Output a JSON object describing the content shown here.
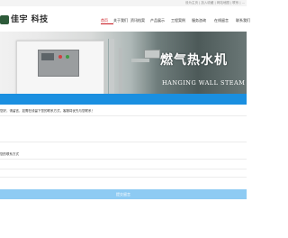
{
  "topbar": {
    "links": "设为主页 | 加入收藏 | 网站地图 | 联系 | ..."
  },
  "header": {
    "logo_text": "佳宇 科技",
    "nav": [
      {
        "label": "首页",
        "active": true
      },
      {
        "label": "关于我们",
        "active": false
      },
      {
        "label": "资讯档案",
        "active": false
      },
      {
        "label": "产品展示",
        "active": false
      },
      {
        "label": "工程案例",
        "active": false
      },
      {
        "label": "服务咨询",
        "active": false
      },
      {
        "label": "在线留言",
        "active": false
      },
      {
        "label": "联系我们",
        "active": false
      }
    ]
  },
  "hero": {
    "title": "燃气热水机",
    "subtitle": "HANGING WALL STEAM ENGINE"
  },
  "form": {
    "notice": "您好，请留言，如需在线留下您的联系方式，客服将优先与您联系！",
    "message_placeholder": "",
    "contact_label": "您的联系方式",
    "contact_placeholder": "",
    "submit_label": "提交留言"
  },
  "colors": {
    "accent": "#1a8fe0",
    "nav_active": "#c8161d",
    "submit": "#8ecbf3"
  }
}
